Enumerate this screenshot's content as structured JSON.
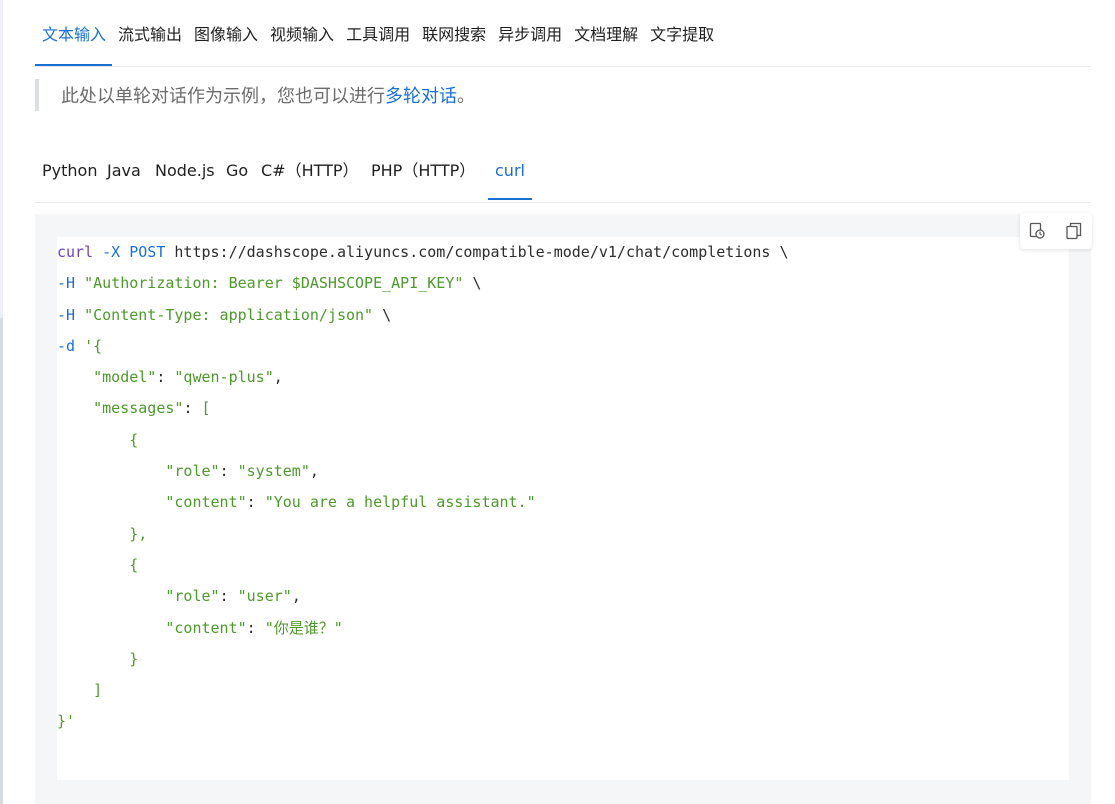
{
  "feature_tabs": [
    {
      "label": "文本输入",
      "active": true
    },
    {
      "label": "流式输出"
    },
    {
      "label": "图像输入"
    },
    {
      "label": "视频输入"
    },
    {
      "label": "工具调用"
    },
    {
      "label": "联网搜索"
    },
    {
      "label": "异步调用"
    },
    {
      "label": "文档理解"
    },
    {
      "label": "文字提取"
    }
  ],
  "note": {
    "text": "此处以单轮对话作为示例，您也可以进行",
    "link": "多轮对话",
    "suffix": "。"
  },
  "lang_tabs": [
    {
      "label": "Python"
    },
    {
      "label": "Java"
    },
    {
      "label": "Node.js"
    },
    {
      "label": "Go"
    },
    {
      "label": "C#（HTTP）"
    },
    {
      "label": "PHP（HTTP）"
    },
    {
      "label": "curl",
      "active": true
    }
  ],
  "toolbar": {
    "icons": [
      "copy-code-icon",
      "copy-icon"
    ]
  },
  "code": {
    "l1_cmd": "curl",
    "l1_flag": "-X",
    "l1_method": "POST",
    "l1_url": "https://dashscope.aliyuncs.com/compatible-mode/v1/chat/completions \\",
    "l2_flag": "-H",
    "l2_str": "\"Authorization: Bearer $DASHSCOPE_API_KEY\"",
    "l2_tail": " \\",
    "l3_flag": "-H",
    "l3_str": "\"Content-Type: application/json\"",
    "l3_tail": " \\",
    "l4_flag": "-d",
    "l4_str": "'{",
    "l5_key": "\"model\"",
    "l5_colon": ": ",
    "l5_val": "\"qwen-plus\"",
    "l5_tail": ",",
    "l6_key": "\"messages\"",
    "l6_colon": ": ",
    "l6_val": "[",
    "l7": "{",
    "l8_key": "\"role\"",
    "l8_colon": ": ",
    "l8_val": "\"system\"",
    "l8_tail": ",",
    "l9_key": "\"content\"",
    "l9_colon": ": ",
    "l9_val": "\"You are a helpful assistant.\"",
    "l10": "},",
    "l11": "{",
    "l12_key": "\"role\"",
    "l12_colon": ": ",
    "l12_val": "\"user\"",
    "l12_tail": ",",
    "l13_key": "\"content\"",
    "l13_colon": ": ",
    "l13_val": "\"你是谁？\"",
    "l14": "}",
    "l15": "]",
    "l16": "}'"
  },
  "colors": {
    "accent": "#1a6fd6",
    "string": "#4c9a2a",
    "keyword": "#6f42c1"
  }
}
